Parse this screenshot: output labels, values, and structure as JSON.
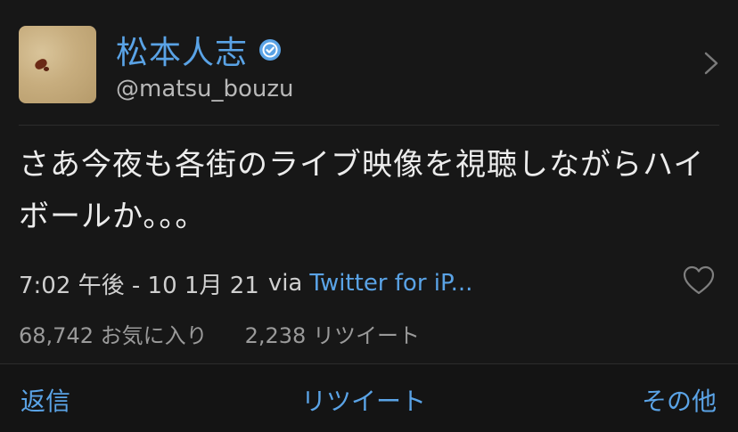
{
  "user": {
    "display_name": "松本人志",
    "handle": "@matsu_bouzu"
  },
  "tweet": {
    "text": "さあ今夜も各街のライブ映像を視聴しながらハイボールか。。。",
    "timestamp": "7:02 午後 - 10 1月 21",
    "via_label": "via",
    "via_app": "Twitter for iP..."
  },
  "stats": {
    "favorites": "68,742 お気に入り",
    "retweets": "2,238 リツイート"
  },
  "actions": {
    "reply": "返信",
    "retweet": "リツイート",
    "more": "その他"
  },
  "icons": {
    "verified": "verified-badge-icon",
    "chevron": "chevron-right-icon",
    "heart": "heart-outline-icon"
  },
  "colors": {
    "background": "#171717",
    "accent": "#5aa3e6",
    "text": "#ececec",
    "muted": "#9a9a9a"
  }
}
